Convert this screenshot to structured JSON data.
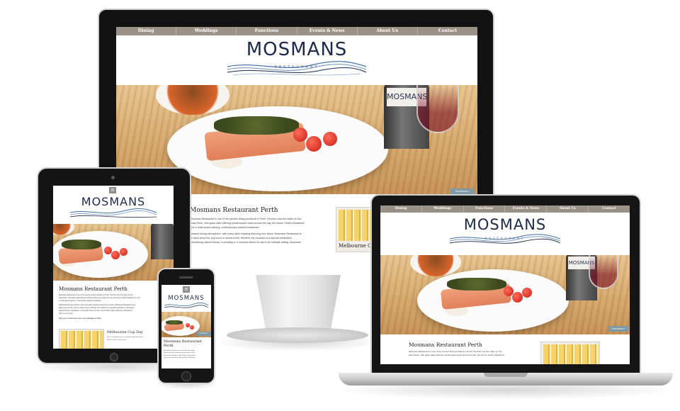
{
  "site": {
    "nav": [
      "Dining",
      "Weddings",
      "Functions",
      "Events & News",
      "About Us",
      "Contact"
    ],
    "logo_title": "MOSMANS",
    "logo_subtitle": "RESTAURANT",
    "bottle_label": "MOSMANS",
    "hero_tag": "Functions »",
    "menu_toggle": "≡"
  },
  "monitor": {
    "heading": "Mosmans Restaurant Perth",
    "paragraphs": [
      "Mosmans Restaurant is one of the premier dining locations in Perth. Perched over the water on the",
      "Swan River, with glass walls offering uninterrupted views across the bay, the former Smith's Boatshed",
      "now a multi-award winning, contemporary seafood restaurant.",
      "Relaxed dining atmosphere, with every table enjoying stunning river views, Mosmans Restaurant is",
      "an ideal venue for any lunch or dinner event. Whether the occasion is a special celebration,",
      "entertaining valued friends, a wedding or a romantic dinner for two in an intimate setting, Mosmans"
    ],
    "side_caption": "Melbourne Cu"
  },
  "tablet": {
    "heading": "Mosmans Restaurant Perth",
    "paragraphs": [
      "Mosmans Restaurant is one of the premier dining locations in Perth. Perched over the water on the",
      "Swan River, with glass walls offering uninterrupted views across the bay, the former Smith's Boatshed is now",
      "a multi-award winning, contemporary seafood restaurant.",
      "Relaxed dining atmosphere, with every table enjoying stunning river views, Mosmans Restaurant is an",
      "ideal venue for any lunch or dinner event. Whether the occasion is a special celebration, entertaining",
      "valued friends, a wedding or a romantic dinner for two in an intimate setting, Mosmans Restaurant",
      "has a menu to suit.",
      "Sign up to receive the news, view packages & offers"
    ],
    "side_caption": "Melbourne Cup Day",
    "side_text": [
      "Join us at Mosmans for a Cup Day celebration with a",
      "delicious three course menu"
    ]
  },
  "phone": {
    "heading_line1": "Mosmans Restaurant",
    "heading_line2": "Perth",
    "paragraphs": [
      "Mosmans Restaurant is one of the premier dining",
      "locations in Perth. Perched over the water on the",
      "Swan River, with glass walls offering uninterrupted",
      "views across the bay, the former Smith's Boatshed"
    ]
  },
  "laptop": {
    "heading": "Mosmans Restaurant Perth",
    "paragraphs": [
      "Mosmans Restaurant is one of the premier dining locations in Perth. Perched over the water on the",
      "Swan River, with glass walls offering uninterrupted views across the bay, the former Smith's Boatshed"
    ]
  },
  "colors": {
    "nav_bg": "#9a9187",
    "logo": "#1d2a4a",
    "wave": "#3f6fa5",
    "tag": "#7e98a6"
  }
}
